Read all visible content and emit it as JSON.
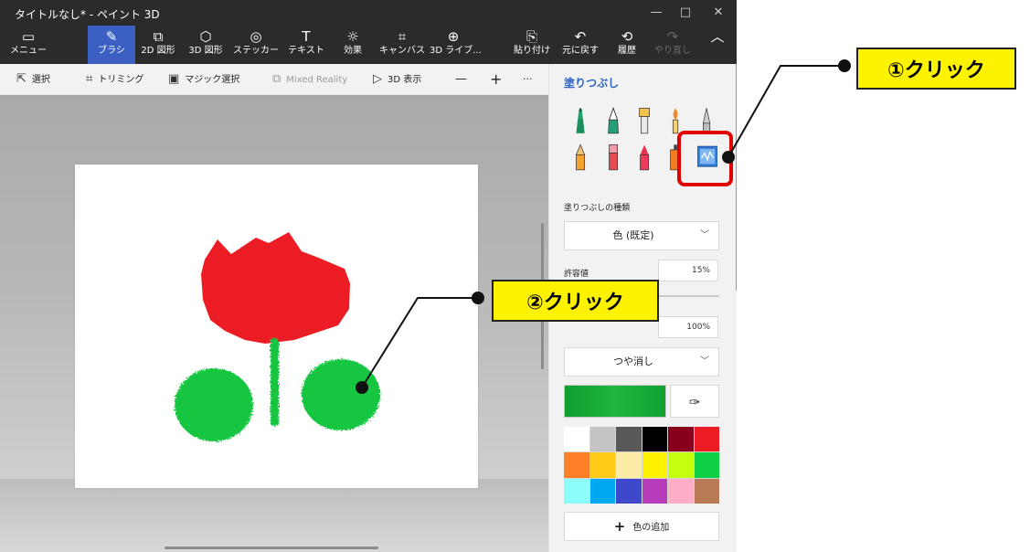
{
  "window": {
    "title": "タイトルなし* - ペイント 3D",
    "controls": [
      "—",
      "□",
      "✕"
    ]
  },
  "ribbon": {
    "items": [
      {
        "icon": "menu-icon",
        "glyph": "▭",
        "label": "メニュー"
      },
      {
        "icon": "brush-icon",
        "glyph": "✎",
        "label": "ブラシ"
      },
      {
        "icon": "shapes-2d-icon",
        "glyph": "⧉",
        "label": "2D 図形"
      },
      {
        "icon": "shapes-3d-icon",
        "glyph": "⬡",
        "label": "3D 図形"
      },
      {
        "icon": "sticker-icon",
        "glyph": "◎",
        "label": "ステッカー"
      },
      {
        "icon": "text-icon",
        "glyph": "T",
        "label": "テキスト"
      },
      {
        "icon": "effects-icon",
        "glyph": "☼",
        "label": "効果"
      },
      {
        "icon": "canvas-icon",
        "glyph": "⌗",
        "label": "キャンバス"
      },
      {
        "icon": "library-3d-icon",
        "glyph": "⊕",
        "label": "3D ライブ..."
      },
      {
        "icon": "paste-icon",
        "glyph": "⎘",
        "label": "貼り付け"
      },
      {
        "icon": "undo-icon",
        "glyph": "↶",
        "label": "元に戻す"
      },
      {
        "icon": "history-icon",
        "glyph": "⟲",
        "label": "履歴"
      },
      {
        "icon": "redo-icon",
        "glyph": "↷",
        "label": "やり直し"
      }
    ],
    "active_item": "ブラシ",
    "collapse_glyph": "︿"
  },
  "toolbar": {
    "select": "選択",
    "crop": "トリミング",
    "magic_select": "マジック選択",
    "mixed_reality": "Mixed Reality",
    "view_3d": "3D 表示",
    "zoom_out": "—",
    "zoom_in": "+",
    "more": "···"
  },
  "panel": {
    "title": "塗りつぶし",
    "fill_type_label": "塗りつぶしの種類",
    "fill_type_value": "色 (既定)",
    "tolerance_label": "許容値",
    "tolerance_value": "15%",
    "opacity_value": "100%",
    "finish_value": "つや消し",
    "add_color": "色の追加",
    "brushes": [
      "marker-icon",
      "calligraphy-pen-icon",
      "oil-brush-icon",
      "watercolor-icon",
      "pixel-pen-icon",
      "pencil-icon",
      "eraser-icon",
      "crayon-icon",
      "spray-can-icon",
      "fill-bucket-icon"
    ],
    "selected_brush": "fill-bucket-icon",
    "current_color": "#1bab3b",
    "palette": [
      "#ffffff",
      "#c3c3c3",
      "#585858",
      "#000000",
      "#88001b",
      "#ec1c24",
      "#ff7f27",
      "#ffca18",
      "#fdeca6",
      "#fff200",
      "#c4ff0e",
      "#0ed145",
      "#8cfffb",
      "#00a8f3",
      "#3f48cc",
      "#b83dba",
      "#ffaec8",
      "#b97a56"
    ]
  },
  "drawing": {
    "tulip_red": "#ec1c24",
    "leaf_green": "#13c63f"
  },
  "callouts": [
    {
      "text": "①クリック"
    },
    {
      "text": "②クリック"
    }
  ]
}
